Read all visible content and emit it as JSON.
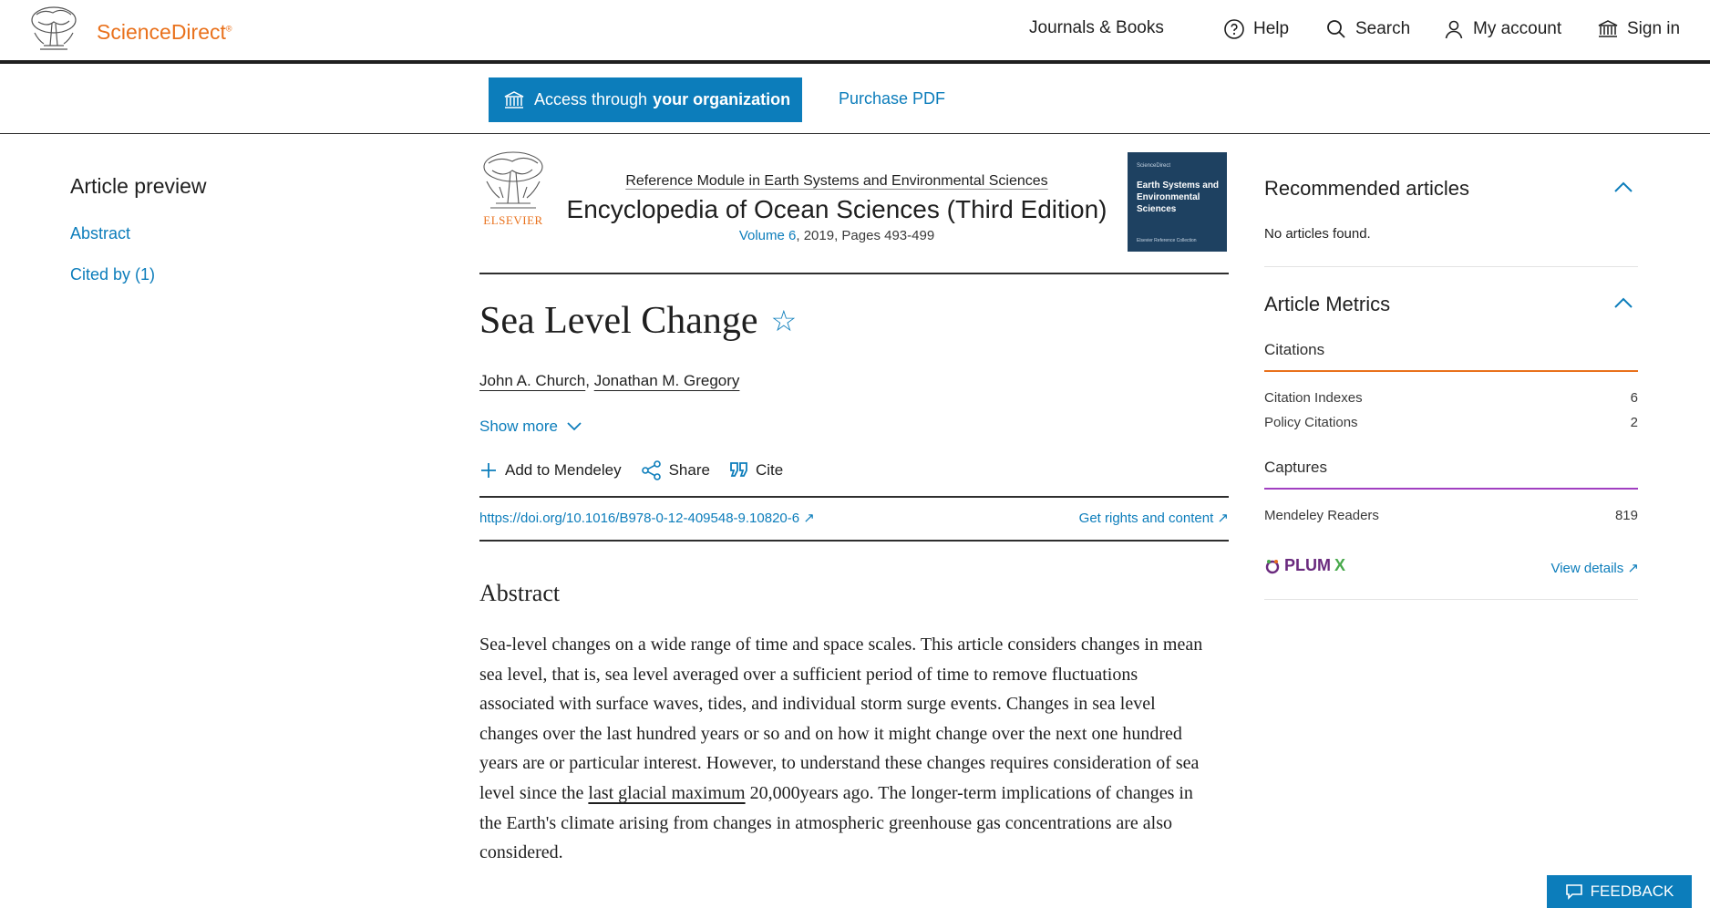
{
  "header": {
    "logo_label": "ScienceDirect",
    "nav": {
      "journals": "Journals & Books",
      "help": "Help",
      "search": "Search",
      "account": "My account",
      "signin": "Sign in"
    }
  },
  "access_bar": {
    "access_prefix": "Access through",
    "access_bold": "your organization",
    "purchase": "Purchase PDF"
  },
  "preview": {
    "title": "Article preview",
    "links": [
      "Abstract",
      "Cited by (1)"
    ]
  },
  "publication": {
    "publisher_word": "ELSEVIER",
    "series": "Reference Module in Earth Systems and Environmental Sciences",
    "title": "Encyclopedia of Ocean Sciences (Third Edition)",
    "volume_link": "Volume 6",
    "volume_rest": ", 2019, Pages 493-499",
    "cover": {
      "small": "ScienceDirect",
      "title": "Earth Systems and Environmental Sciences",
      "foot": "Elsevier Reference Collection"
    }
  },
  "article": {
    "title": "Sea Level Change",
    "authors": [
      "John A. Church",
      "Jonathan M. Gregory"
    ],
    "show_more": "Show more",
    "actions": {
      "mendeley": "Add to Mendeley",
      "share": "Share",
      "cite": "Cite"
    },
    "doi": "https://doi.org/10.1016/B978-0-12-409548-9.10820-6",
    "rights": "Get rights and content",
    "abstract_heading": "Abstract",
    "abstract_before_link": "Sea-level changes on a wide range of time and space scales. This article considers changes in mean sea level, that is, sea level averaged over a sufficient period of time to remove fluctuations associated with surface waves, tides, and individual storm surge events. Changes in sea level changes over the last hundred years or so and on how it might change over the next one hundred years are or particular interest. However, to understand these changes requires consideration of sea level since the ",
    "abstract_link": "last glacial maximum",
    "abstract_after_link": " 20,000years ago. The longer-term implications of changes in the Earth's climate arising from changes in atmospheric greenhouse gas concentrations are also considered."
  },
  "sidebar": {
    "recommended_title": "Recommended articles",
    "recommended_empty": "No articles found.",
    "metrics_title": "Article Metrics",
    "citations_label": "Citations",
    "citations": [
      {
        "label": "Citation Indexes",
        "value": "6"
      },
      {
        "label": "Policy Citations",
        "value": "2"
      }
    ],
    "captures_label": "Captures",
    "captures": [
      {
        "label": "Mendeley Readers",
        "value": "819"
      }
    ],
    "plumx_label": "PLUM",
    "plumx_x": "X",
    "view_details": "View details"
  },
  "feedback": "FEEDBACK",
  "colors": {
    "brand_orange": "#e9711c",
    "link_blue": "#0c7dbb",
    "citations_accent": "#e9711c",
    "captures_accent": "#a13fc1"
  }
}
